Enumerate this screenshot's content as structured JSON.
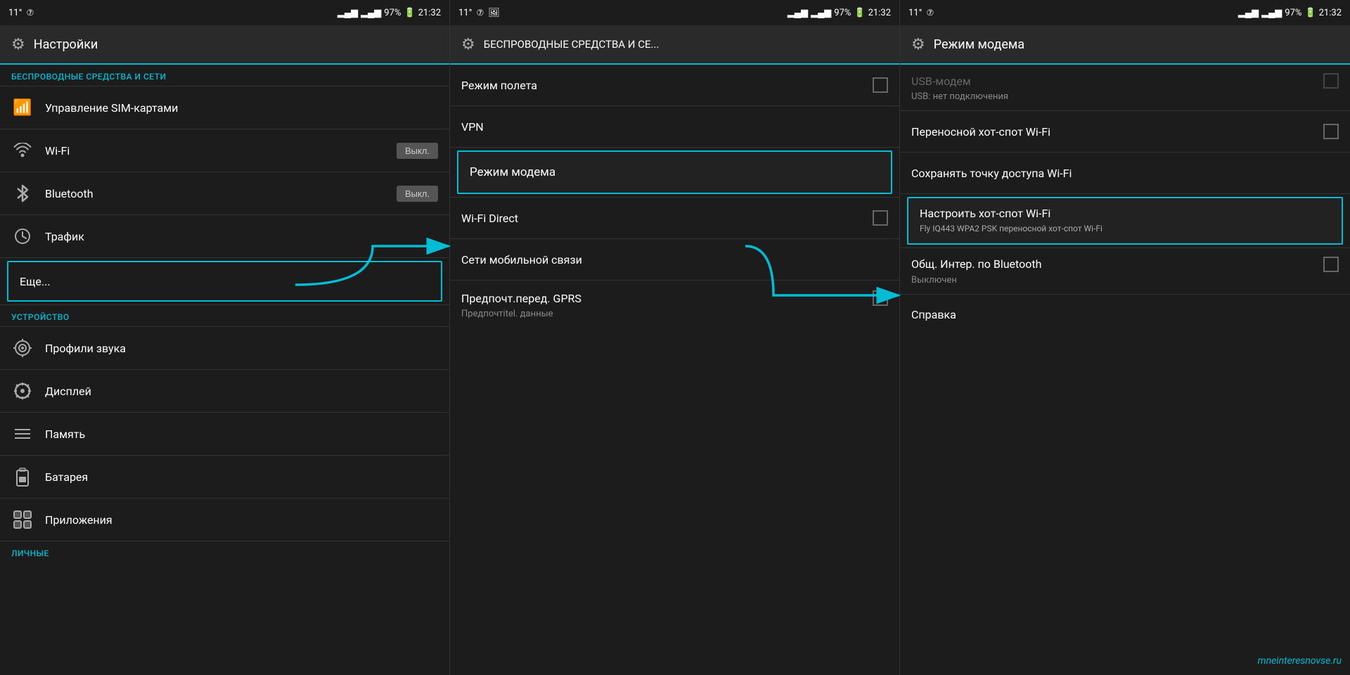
{
  "panel1": {
    "statusBar": {
      "temp": "11°",
      "battery": "97%",
      "time": "21:32"
    },
    "header": {
      "title": "Настройки"
    },
    "sectionWireless": "БЕСПРОВОДНЫЕ СРЕДСТВА И СЕТИ",
    "items": [
      {
        "id": "sim",
        "icon": "📶",
        "label": "Управление SIM-картами",
        "toggle": null
      },
      {
        "id": "wifi",
        "icon": "📡",
        "label": "Wi-Fi",
        "toggle": "Выкл."
      },
      {
        "id": "bluetooth",
        "icon": "🔷",
        "label": "Bluetooth",
        "toggle": "Выкл."
      },
      {
        "id": "traffic",
        "icon": "🕐",
        "label": "Трафик",
        "toggle": null
      },
      {
        "id": "more",
        "icon": null,
        "label": "Еще...",
        "toggle": null,
        "highlighted": true
      }
    ],
    "sectionDevice": "УСТРОЙСТВО",
    "deviceItems": [
      {
        "id": "sound",
        "icon": "🔊",
        "label": "Профили звука"
      },
      {
        "id": "display",
        "icon": "⚙",
        "label": "Дисплей"
      },
      {
        "id": "memory",
        "icon": "☰",
        "label": "Память"
      },
      {
        "id": "battery",
        "icon": "🔋",
        "label": "Батарея"
      },
      {
        "id": "apps",
        "icon": "📱",
        "label": "Приложения"
      }
    ],
    "sectionPersonal": "ЛИЧНЫЕ"
  },
  "panel2": {
    "statusBar": {
      "temp": "11°",
      "battery": "97%",
      "time": "21:32"
    },
    "header": {
      "title": "БЕСПРОВОДНЫЕ СРЕДСТВА И СЕ..."
    },
    "items": [
      {
        "id": "airplane",
        "label": "Режим полета",
        "checkbox": true,
        "checked": false
      },
      {
        "id": "vpn",
        "label": "VPN",
        "checkbox": false
      },
      {
        "id": "modem",
        "label": "Режим модема",
        "checkbox": false,
        "highlighted": true
      },
      {
        "id": "wifidirect",
        "label": "Wi-Fi Direct",
        "checkbox": true,
        "checked": false
      },
      {
        "id": "mobile",
        "label": "Сети мобильной связи",
        "checkbox": false
      },
      {
        "id": "gprs",
        "label": "Предпочт.перед. GPRS",
        "sub": "Предпочтitel. данные",
        "checkbox": true,
        "checked": false
      }
    ]
  },
  "panel3": {
    "statusBar": {
      "temp": "11°",
      "battery": "97%",
      "time": "21:32"
    },
    "header": {
      "title": "Режим модема"
    },
    "items": [
      {
        "id": "usbmodem",
        "label": "USB-модем",
        "sub": "USB: нет подключения",
        "checkbox": true,
        "checked": false,
        "disabled": true
      },
      {
        "id": "hotspot",
        "label": "Переносной хот-спот Wi-Fi",
        "checkbox": true,
        "checked": false
      },
      {
        "id": "savehotspot",
        "label": "Сохранять точку доступа Wi-Fi",
        "checkbox": false
      },
      {
        "id": "confighotspot",
        "label": "Настроить хот-спот Wi-Fi",
        "sub": "Fly IQ443 WPA2 PSK переносной хот-спот Wi-Fi",
        "checkbox": false,
        "highlighted": true
      },
      {
        "id": "bluetooth_share",
        "label": "Общ. Интер. по Bluetooth",
        "sub": "Выключен",
        "checkbox": true,
        "checked": false
      },
      {
        "id": "help",
        "label": "Справка",
        "checkbox": false
      }
    ],
    "watermark": "mneinteresnovse.ru"
  }
}
